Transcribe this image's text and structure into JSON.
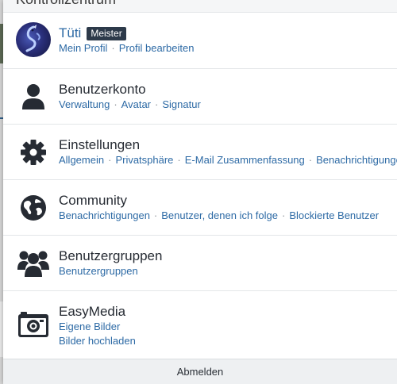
{
  "panel": {
    "title": "Kontrollzentrum"
  },
  "user": {
    "name": "Tüti",
    "rank_badge": "Meister",
    "links": [
      "Mein Profil",
      "Profil bearbeiten"
    ]
  },
  "sections": [
    {
      "icon": "user-icon",
      "title": "Benutzerkonto",
      "links": [
        "Verwaltung",
        "Avatar",
        "Signatur"
      ]
    },
    {
      "icon": "gear-icon",
      "title": "Einstellungen",
      "links": [
        "Allgemein",
        "Privatsphäre",
        "E-Mail Zusammenfassung",
        "Benachrichtigungen"
      ]
    },
    {
      "icon": "globe-icon",
      "title": "Community",
      "links": [
        "Benachrichtigungen",
        "Benutzer, denen ich folge",
        "Blockierte Benutzer"
      ]
    },
    {
      "icon": "users-icon",
      "title": "Benutzergruppen",
      "links": [
        "Benutzergruppen"
      ]
    },
    {
      "icon": "camera-icon",
      "title": "EasyMedia",
      "links": [
        "Eigene Bilder",
        "Bilder hochladen"
      ]
    }
  ],
  "footer": {
    "logout_label": "Abmelden"
  },
  "colors": {
    "link": "#2d6aa5",
    "icon": "#262b33",
    "badge": "#2d3a4a"
  }
}
